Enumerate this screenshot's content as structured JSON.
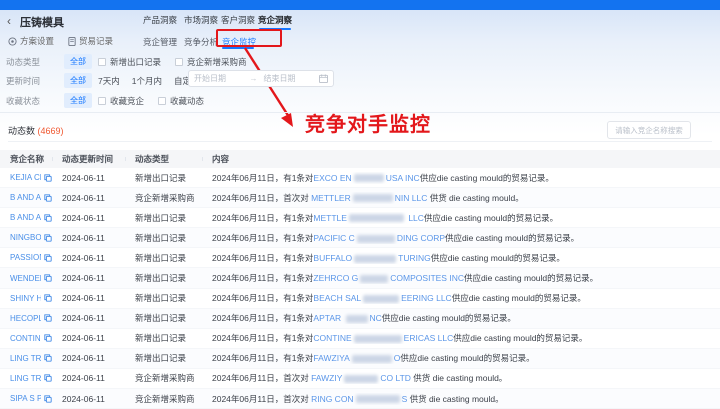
{
  "header": {
    "back_icon": "‹",
    "title": "压铸模具",
    "action_settings": "方案设置",
    "action_trade": "贸易记录",
    "tabs": {
      "t1": "产品洞察",
      "t2": "市场洞察",
      "t3": "客户洞察",
      "t4": "竞企洞察"
    },
    "subtabs": {
      "s1": "竞企管理",
      "s2": "竞争分析",
      "s3": "竞企监控"
    }
  },
  "annotation": {
    "text": "竞争对手监控",
    "color": "#e3171b"
  },
  "filters": {
    "row1": {
      "label": "动态类型",
      "all": "全部",
      "cb1": "新增出口记录",
      "cb2": "竞企新增采购商"
    },
    "row2": {
      "label": "更新时间",
      "all": "全部",
      "opt1": "7天内",
      "opt2": "1个月内",
      "opt3": "自定义",
      "start_placeholder": "开始日期",
      "arrow": "→",
      "end_placeholder": "结束日期"
    },
    "row3": {
      "label": "收藏状态",
      "all": "全部",
      "cb1": "收藏竞企",
      "cb2": "收藏动态"
    }
  },
  "list": {
    "count_label": "动态数",
    "count_display": "(4669)",
    "search_placeholder": "请输入竞企名称搜索"
  },
  "table": {
    "headers": [
      "竞企名称",
      "动态更新时间",
      "动态类型",
      "内容"
    ],
    "rows": [
      {
        "name": "KEJIA CHA...",
        "date": "2024-06-11",
        "type": "新增出口记录",
        "content": [
          [
            "t",
            "2024年06月11日，有1条对"
          ],
          [
            "l",
            "EXCO EN"
          ],
          [
            "b",
            30
          ],
          [
            "l",
            "USA INC"
          ],
          [
            "t",
            "供应die casting mould的贸易记录。"
          ]
        ]
      },
      {
        "name": "B AND A P...",
        "date": "2024-06-11",
        "type": "竞企新增采购商",
        "content": [
          [
            "t",
            "2024年06月11日，首次对 "
          ],
          [
            "l",
            "METTLER"
          ],
          [
            "b",
            40
          ],
          [
            "l",
            "NIN LLC"
          ],
          [
            "t",
            " 供货 die casting mould。"
          ]
        ]
      },
      {
        "name": "B AND A P...",
        "date": "2024-06-11",
        "type": "新增出口记录",
        "content": [
          [
            "t",
            "2024年06月11日，有1条对"
          ],
          [
            "l",
            "METTLE"
          ],
          [
            "b",
            55
          ],
          [
            "l",
            " LLC"
          ],
          [
            "t",
            "供应die casting mould的贸易记录。"
          ]
        ]
      },
      {
        "name": "NINGBO M...",
        "date": "2024-06-11",
        "type": "新增出口记录",
        "content": [
          [
            "t",
            "2024年06月11日，有1条对"
          ],
          [
            "l",
            "PACIFIC C"
          ],
          [
            "b",
            38
          ],
          [
            "l",
            "DING CORP"
          ],
          [
            "t",
            "供应die casting mould的贸易记录。"
          ]
        ]
      },
      {
        "name": "PASSION M...",
        "date": "2024-06-11",
        "type": "新增出口记录",
        "content": [
          [
            "t",
            "2024年06月11日，有1条对"
          ],
          [
            "l",
            "BUFFALO"
          ],
          [
            "b",
            42
          ],
          [
            "l",
            "TURING"
          ],
          [
            "t",
            "供应die casting mould的贸易记录。"
          ]
        ]
      },
      {
        "name": "WENDENG ...",
        "date": "2024-06-11",
        "type": "新增出口记录",
        "content": [
          [
            "t",
            "2024年06月11日，有1条对"
          ],
          [
            "l",
            "ZEHRCO G"
          ],
          [
            "b",
            28
          ],
          [
            "l",
            "COMPOSITES INC"
          ],
          [
            "t",
            "供应die casting mould的贸易记录。"
          ]
        ]
      },
      {
        "name": "SHINY HK I...",
        "date": "2024-06-11",
        "type": "新增出口记录",
        "content": [
          [
            "t",
            "2024年06月11日，有1条对"
          ],
          [
            "l",
            "BEACH SAL"
          ],
          [
            "b",
            36
          ],
          [
            "l",
            "EERING LLC"
          ],
          [
            "t",
            "供应die casting mould的贸易记录。"
          ]
        ]
      },
      {
        "name": "HECOPLAS...",
        "date": "2024-06-11",
        "type": "新增出口记录",
        "content": [
          [
            "t",
            "2024年06月11日，有1条对"
          ],
          [
            "l",
            "APTAR "
          ],
          [
            "b",
            22
          ],
          [
            "l",
            "NC"
          ],
          [
            "t",
            "供应die casting mould的贸易记录。"
          ]
        ]
      },
      {
        "name": "CONTINEN...",
        "date": "2024-06-11",
        "type": "新增出口记录",
        "content": [
          [
            "t",
            "2024年06月11日，有1条对"
          ],
          [
            "l",
            "CONTINE"
          ],
          [
            "b",
            48
          ],
          [
            "l",
            "ERICAS LLC"
          ],
          [
            "t",
            "供应die casting mould的贸易记录。"
          ]
        ]
      },
      {
        "name": "LING TRADI...",
        "date": "2024-06-11",
        "type": "新增出口记录",
        "content": [
          [
            "t",
            "2024年06月11日，有1条对"
          ],
          [
            "l",
            "FAWZIYA"
          ],
          [
            "b",
            40
          ],
          [
            "l",
            "O"
          ],
          [
            "t",
            "供应die casting mould的贸易记录。"
          ]
        ]
      },
      {
        "name": "LING TRADI...",
        "date": "2024-06-11",
        "type": "竞企新增采购商",
        "content": [
          [
            "t",
            "2024年06月11日，首次对 "
          ],
          [
            "l",
            "FAWZIY"
          ],
          [
            "b",
            34
          ],
          [
            "l",
            "CO LTD"
          ],
          [
            "t",
            " 供货 die casting mould。"
          ]
        ]
      },
      {
        "name": "SIPA S P A S...",
        "date": "2024-06-11",
        "type": "竞企新增采购商",
        "content": [
          [
            "t",
            "2024年06月11日，首次对 "
          ],
          [
            "l",
            "RING CON"
          ],
          [
            "b",
            44
          ],
          [
            "l",
            "S"
          ],
          [
            "t",
            " 供货 die casting mould。"
          ]
        ]
      }
    ]
  },
  "colors": {
    "primary": "#1677ff",
    "topbar": "#1373f0",
    "annotation_red": "#e3171b",
    "count_orange": "#f0572f",
    "link_blue": "#5b96e8"
  }
}
